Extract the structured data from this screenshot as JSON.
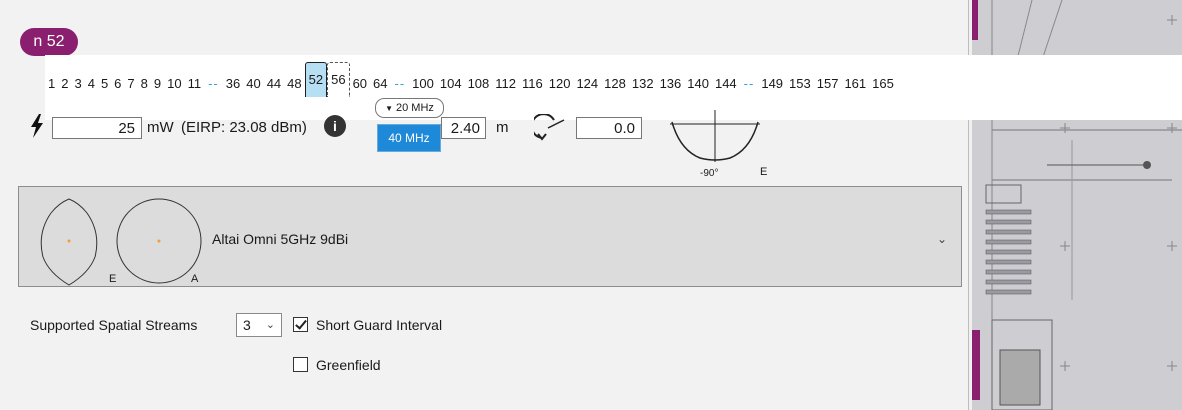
{
  "band": {
    "label": "n 52",
    "color": "#8a1f6f"
  },
  "channels": {
    "items": [
      "1",
      "2",
      "3",
      "4",
      "5",
      "6",
      "7",
      "8",
      "9",
      "10",
      "11",
      "--",
      "36",
      "40",
      "44",
      "48",
      "52",
      "56",
      "60",
      "64",
      "--",
      "100",
      "104",
      "108",
      "112",
      "116",
      "120",
      "124",
      "128",
      "132",
      "136",
      "140",
      "144",
      "--",
      "149",
      "153",
      "157",
      "161",
      "165"
    ],
    "selected": "52",
    "bonded_partner": "56",
    "selected_color": "#b7dff4",
    "gap_color": "#3aa0e0"
  },
  "bandwidth": {
    "current": "20 MHz",
    "option": "40 MHz",
    "option_color": "#1e88d9"
  },
  "power": {
    "value": "25",
    "unit": "mW",
    "eirp": "(EIRP: 23.08 dBm)"
  },
  "height": {
    "value": "2.40",
    "unit": "m"
  },
  "tilt": {
    "value": "0.0"
  },
  "elevation": {
    "left_label": "-90°",
    "right_label": "E"
  },
  "antenna": {
    "name": "Altai Omni 5GHz 9dBi",
    "pattern_e_label": "E",
    "pattern_a_label": "A"
  },
  "streams": {
    "label": "Supported Spatial Streams",
    "value": "3"
  },
  "options": {
    "short_guard_interval": {
      "label": "Short Guard Interval",
      "checked": true
    },
    "greenfield": {
      "label": "Greenfield",
      "checked": false
    }
  }
}
